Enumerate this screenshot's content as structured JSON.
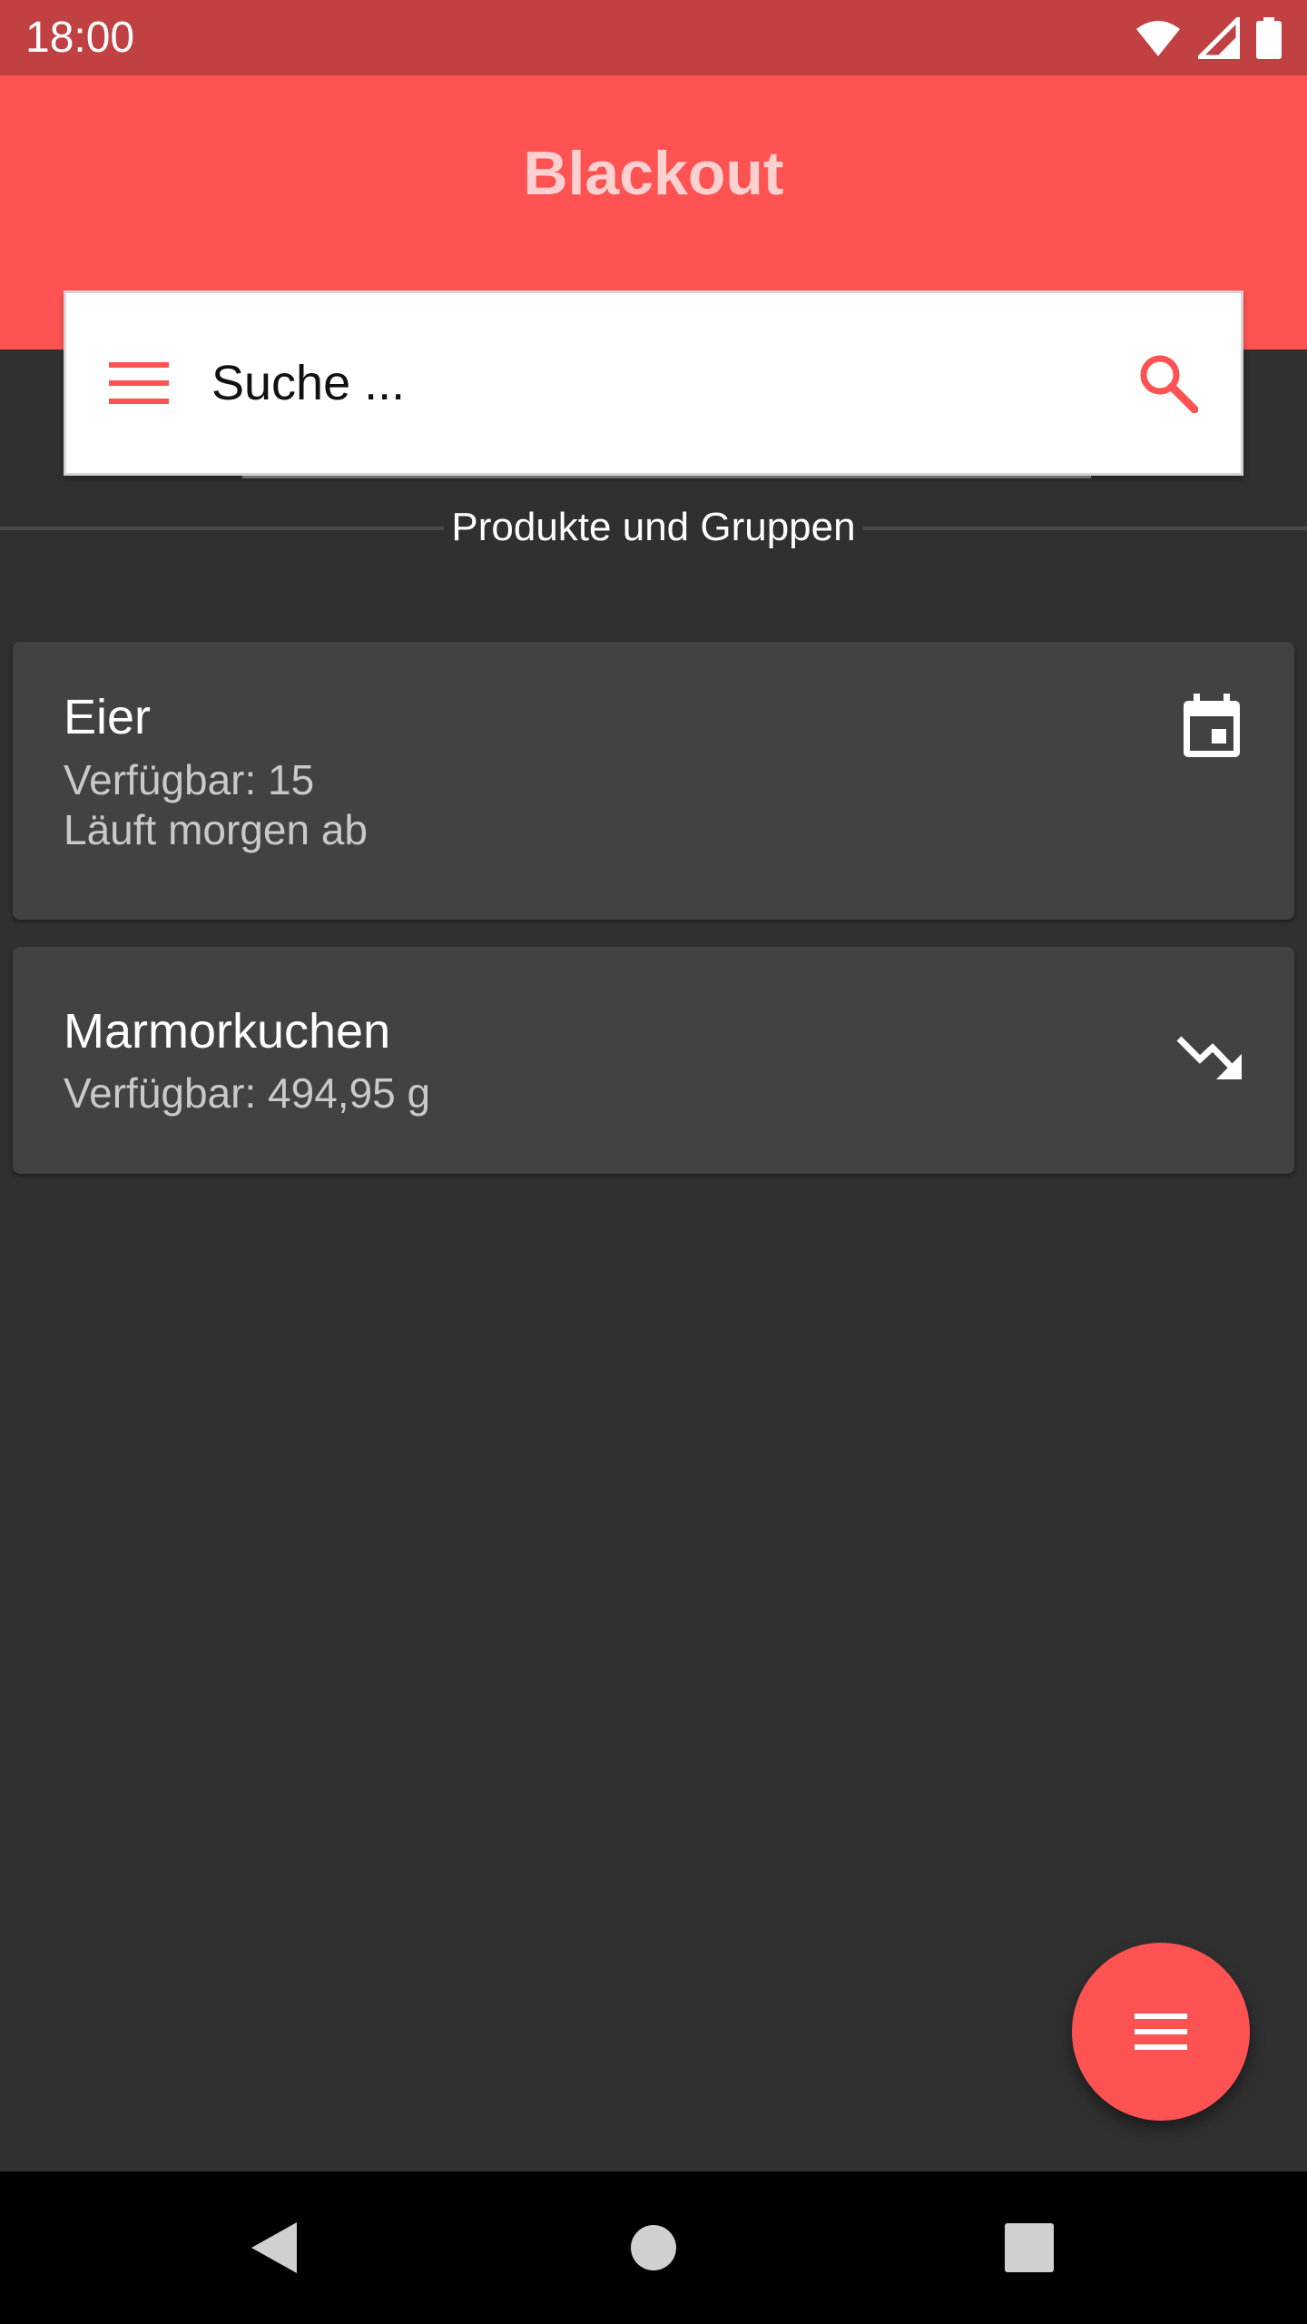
{
  "status_bar": {
    "time": "18:00",
    "icons": [
      "wifi-icon",
      "signal-icon",
      "battery-icon"
    ]
  },
  "app_bar": {
    "title": "Blackout"
  },
  "search": {
    "placeholder": "Suche ...",
    "menu_icon": "menu-icon",
    "search_icon": "search-icon"
  },
  "section": {
    "label": "Produkte und Gruppen"
  },
  "items": [
    {
      "name": "Eier",
      "available": "Verfügbar: 15",
      "expiry": "Läuft morgen ab",
      "icon": "calendar-icon"
    },
    {
      "name": "Marmorkuchen",
      "available": "Verfügbar: 494,95 g",
      "icon": "trending-down-icon"
    }
  ],
  "fab": {
    "icon": "menu-icon"
  },
  "nav": {
    "buttons": [
      "back-icon",
      "home-icon",
      "recents-icon"
    ]
  },
  "colors": {
    "primary": "#ff5252",
    "primary_dark": "#c14042",
    "background": "#303030",
    "card": "#424242"
  }
}
